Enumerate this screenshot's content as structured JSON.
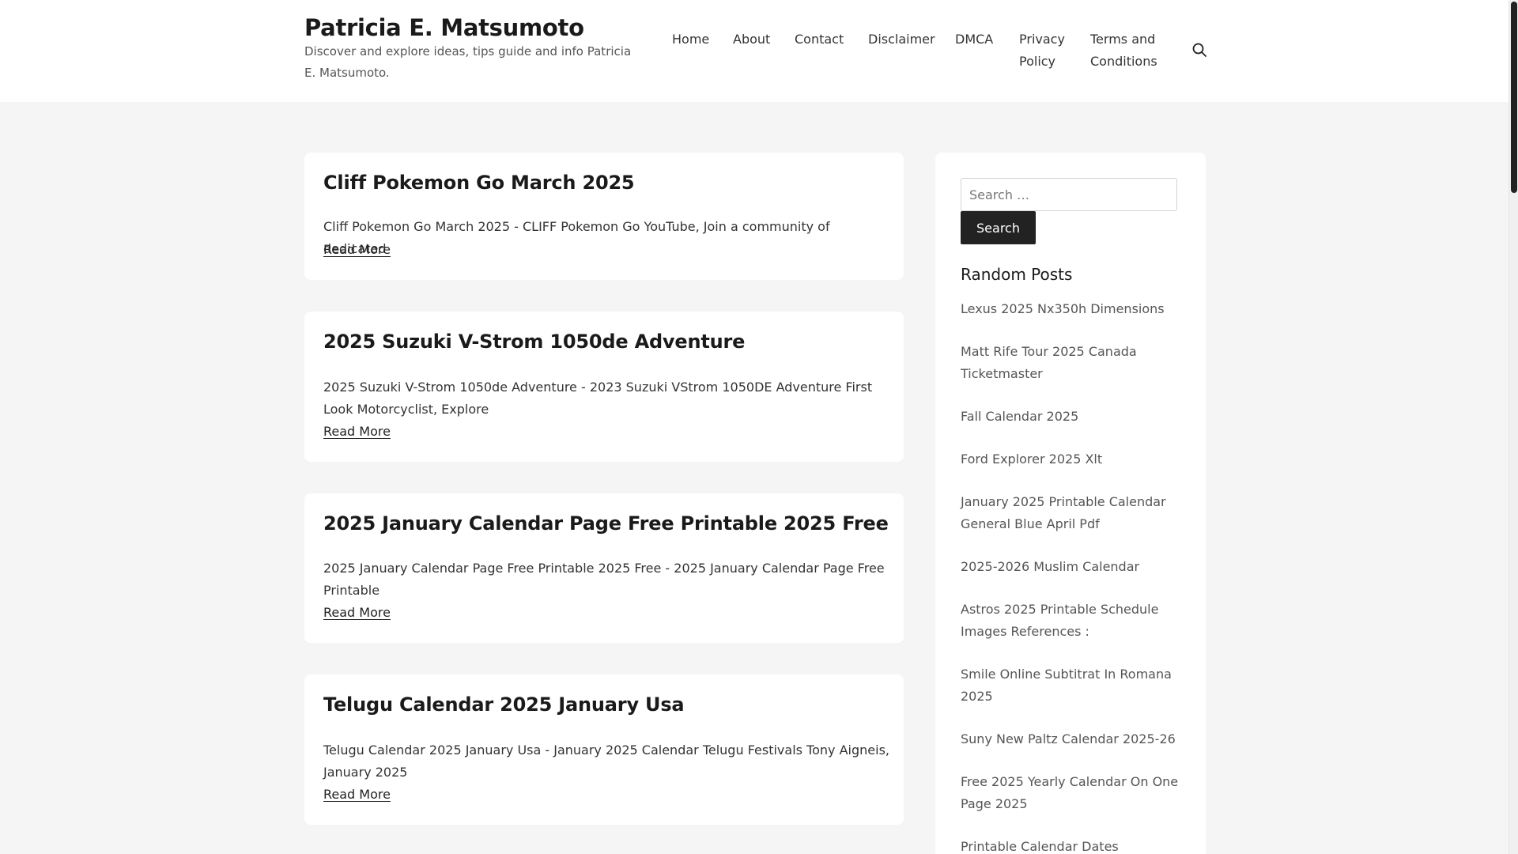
{
  "header": {
    "site_title": "Patricia E. Matsumoto",
    "site_description": "Discover and explore ideas, tips guide and info Patricia E. Matsumoto."
  },
  "nav": {
    "items": [
      {
        "label": "Home"
      },
      {
        "label": "About"
      },
      {
        "label": "Contact"
      },
      {
        "label": "Disclaimer"
      },
      {
        "label": "DMCA"
      },
      {
        "label": "Privacy\nPolicy"
      },
      {
        "label": "Terms and\nConditions"
      }
    ],
    "search_icon": "search-icon"
  },
  "posts": [
    {
      "title": "Cliff Pokemon Go March 2025",
      "excerpt": "Cliff Pokemon Go March 2025 - CLIFF Pokemon Go YouTube, Join a community of dedicated",
      "read_more": "Read More"
    },
    {
      "title": "2025 Suzuki V-Strom 1050de Adventure",
      "excerpt": "2025 Suzuki V-Strom 1050de Adventure - 2023 Suzuki VStrom 1050DE Adventure First Look Motorcyclist, Explore",
      "read_more": "Read More"
    },
    {
      "title": "2025 January Calendar Page Free Printable 2025 Free",
      "excerpt": "2025 January Calendar Page Free Printable 2025 Free - 2025 January Calendar Page Free Printable",
      "read_more": "Read More"
    },
    {
      "title": "Telugu Calendar 2025 January Usa",
      "excerpt": "Telugu Calendar 2025 January Usa - January 2025 Calendar Telugu Festivals Tony Aigneis, January 2025",
      "read_more": "Read More"
    }
  ],
  "sidebar": {
    "search_placeholder": "Search …",
    "search_button": "Search",
    "random_posts_title": "Random Posts",
    "random_posts": [
      "Lexus 2025 Nx350h Dimensions",
      "Matt Rife Tour 2025 Canada Ticketmaster",
      "Fall Calendar 2025",
      "Ford Explorer 2025 Xlt",
      "January 2025 Printable Calendar General Blue April Pdf",
      "2025-2026 Muslim Calendar",
      "Astros 2025 Printable Schedule Images References :",
      "Smile Online Subtitrat In Romana 2025",
      "Suny New Paltz Calendar 2025-26",
      "Free 2025 Yearly Calendar On One Page 2025",
      "Printable Calendar Dates"
    ]
  }
}
